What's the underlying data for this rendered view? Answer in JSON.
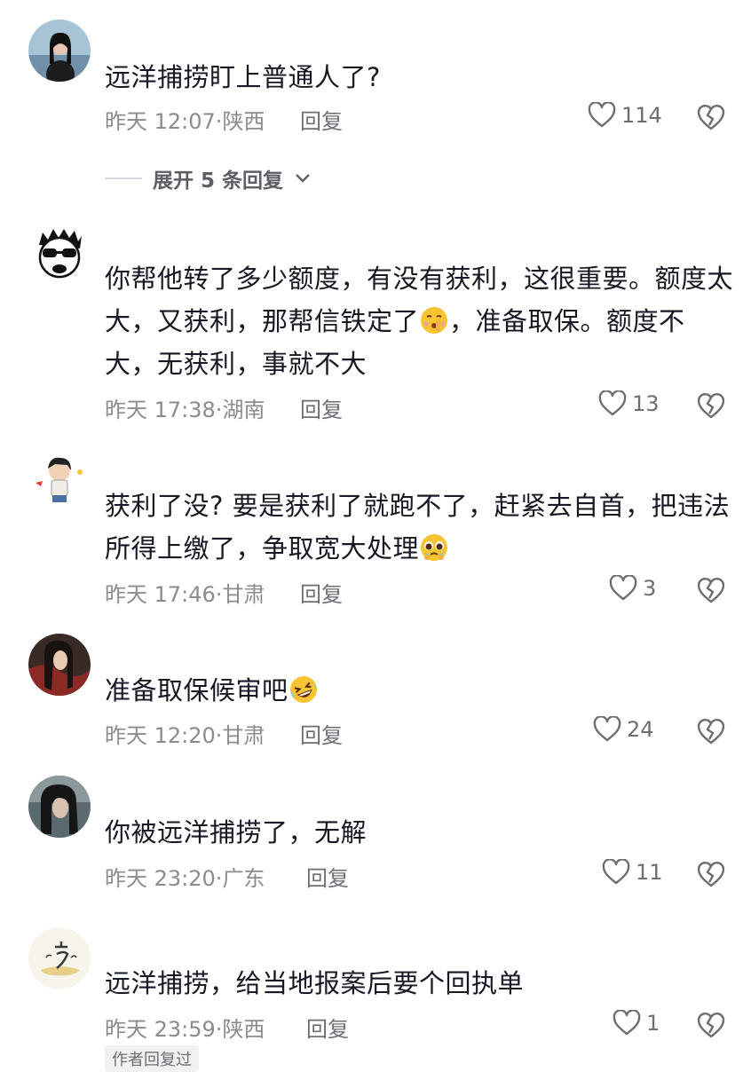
{
  "comments": [
    {
      "text": "远洋捕捞盯上普通人了?",
      "time": "昨天 12:07",
      "location": "陕西",
      "reply": "回复",
      "likes": "114",
      "expand": "展开 5 条回复"
    },
    {
      "text_before_emoji": "你帮他转了多少额度，有没有获利，这很重要。额度太大，又获利，那帮信铁定了",
      "text_after_emoji": "，准备取保。额度不大，无获利，事就不大",
      "time": "昨天 17:38",
      "location": "湖南",
      "reply": "回复",
      "likes": "13"
    },
    {
      "text_before_emoji": "获利了没? 要是获利了就跑不了，赶紧去自首，把违法所得上缴了，争取宽大处理",
      "time": "昨天 17:46",
      "location": "甘肃",
      "reply": "回复",
      "likes": "3"
    },
    {
      "text_before_emoji": "准备取保候审吧",
      "time": "昨天 12:20",
      "location": "甘肃",
      "reply": "回复",
      "likes": "24"
    },
    {
      "text": "你被远洋捕捞了，无解",
      "time": "昨天 23:20",
      "location": "广东",
      "reply": "回复",
      "likes": "11"
    },
    {
      "text": "远洋捕捞，给当地报案后要个回执单",
      "time": "昨天 23:59",
      "location": "陕西",
      "reply": "回复",
      "likes": "1",
      "author_tag": "作者回复过"
    }
  ],
  "icons": {
    "like": "heart-outline-icon",
    "dislike": "broken-heart-icon",
    "expand": "chevron-down-icon",
    "emoji_2": "shushing-face-emoji",
    "emoji_3": "pleading-face-emoji",
    "emoji_4": "rolling-laughing-emoji"
  },
  "colors": {
    "text": "#161823",
    "meta": "#8a8b91",
    "secondary": "#6d6e75",
    "emoji_yellow": "#f7c531"
  }
}
